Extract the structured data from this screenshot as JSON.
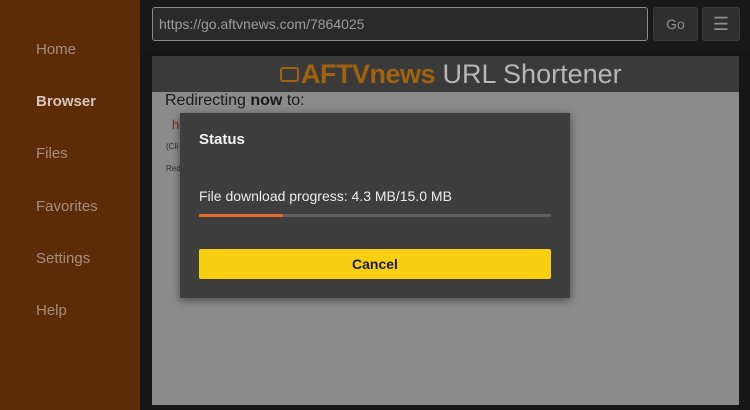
{
  "sidebar": {
    "items": [
      {
        "label": "Home"
      },
      {
        "label": "Browser"
      },
      {
        "label": "Files"
      },
      {
        "label": "Favorites"
      },
      {
        "label": "Settings"
      },
      {
        "label": "Help"
      }
    ],
    "active": "Browser",
    "background_color": "#5c2b08"
  },
  "toolbar": {
    "url_value": "https://go.aftvnews.com/7864025",
    "go_label": "Go",
    "menu_label": "☰",
    "menu_icon": "hamburger-menu-icon"
  },
  "webpage": {
    "site_brand": "AFTVnews",
    "site_title_rest": " URL Shortener",
    "brand_icon": "tv-icon",
    "redirect_prefix": "Redirecting ",
    "redirect_bold": "now",
    "redirect_suffix": " to:",
    "fragment_link": "h",
    "fragment_cli": "(Cli",
    "fragment_red": "Red"
  },
  "dialog": {
    "title": "Status",
    "progress_text": "File download progress: 4.3 MB/15.0 MB",
    "progress_fraction": 0.24,
    "progress_color": "#e66a28",
    "cancel_label": "Cancel",
    "cancel_color": "#f8cf10"
  }
}
